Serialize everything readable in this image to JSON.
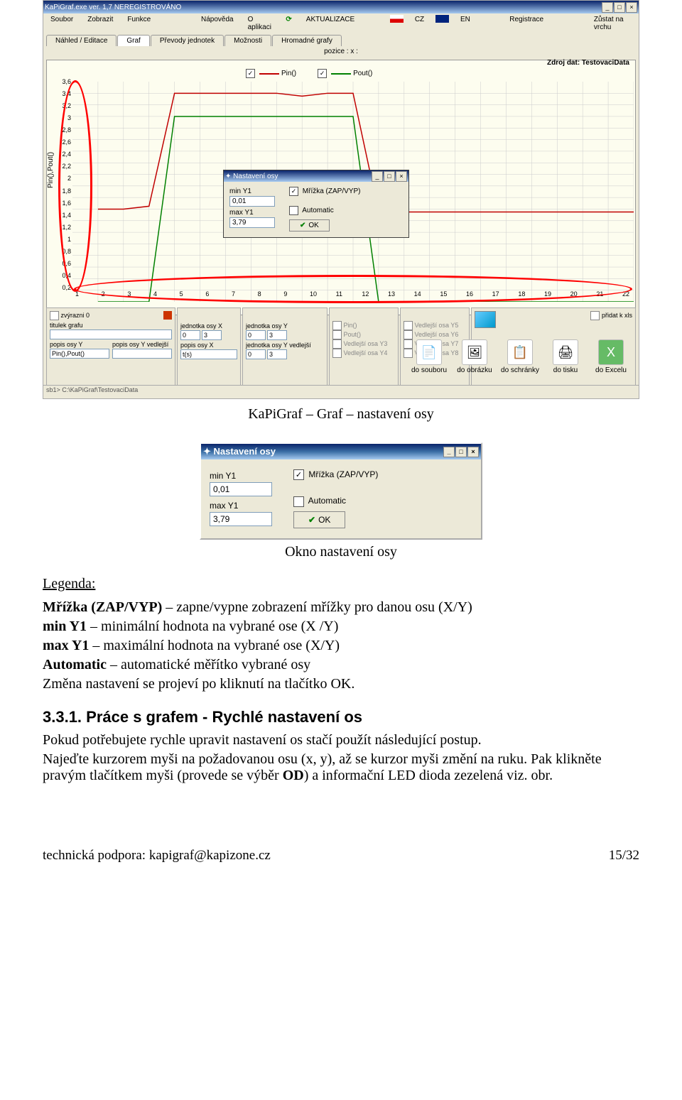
{
  "bigShot": {
    "title": "KaPiGraf.exe  ver. 1,7  NEREGISTROVÁNO",
    "menubar": [
      "Soubor",
      "Zobrazit",
      "Funkce",
      "Nápověda",
      "O aplikaci"
    ],
    "menubar2_update": "AKTUALIZACE",
    "langs": [
      "CZ",
      "EN"
    ],
    "menubar2_right": [
      "Registrace",
      "Zůstat na vrchu"
    ],
    "tabs": [
      "Náhled / Editace",
      "Graf",
      "Převody jednotek",
      "Možnosti",
      "Hromadné grafy"
    ],
    "poziceLabel": "pozice :   x :",
    "legendTitle": "Zdroj dat: TestovaciData",
    "legendItems": [
      "Pin()",
      "Pout()"
    ],
    "ylabel": "Pin(),Pout()",
    "xlabel": "t(s)",
    "yticks": [
      "3,6",
      "3,4",
      "3,2",
      "3",
      "2,8",
      "2,6",
      "2,4",
      "2,2",
      "2",
      "1,8",
      "1,6",
      "1,4",
      "1,2",
      "1",
      "0,8",
      "0,6",
      "0,4",
      "0,2"
    ],
    "xticks": [
      "1",
      "2",
      "3",
      "4",
      "5",
      "6",
      "7",
      "8",
      "9",
      "10",
      "11",
      "12",
      "13",
      "14",
      "15",
      "16",
      "17",
      "18",
      "19",
      "20",
      "21",
      "22"
    ],
    "dlg": {
      "title": "Nastavení osy",
      "minLbl": "min Y1",
      "minVal": "0,01",
      "maxLbl": "max Y1",
      "maxVal": "3,79",
      "grid": "Mřížka (ZAP/VYP)",
      "auto": "Automatic",
      "ok": "OK"
    },
    "bottomLeft": {
      "zv0": "zvýrazni 0",
      "titulek": "titulek grafu",
      "popisY": "popis osy Y",
      "popisYvedl": "popis osy Y vedlejší",
      "popisYval": "Pin(),Pout()",
      "jedX": "jednotka osy X",
      "popisX": "popis osy X",
      "popisXval": "t(s)",
      "jedY": "jednotka osy Y",
      "jedYvedl": "jednotka osy Y vedlejší",
      "val0": "0",
      "val3": "3"
    },
    "seriesChecks": [
      "Pin()",
      "Pout()",
      "Vedlejší osa Y3",
      "Vedlejší osa Y4",
      "Vedlejší osa Y5",
      "Vedlejší osa Y6",
      "Vedlejší osa Y7",
      "Vedlejší osa Y8"
    ],
    "pridat": "přidat k xls",
    "export": [
      "do souboru",
      "do obrázku",
      "do schránky",
      "do tisku",
      "do Excelu"
    ],
    "status": "sb1> C:\\KaPiGraf\\TestovaciData"
  },
  "dialog2": {
    "title": "Nastavení osy",
    "minLbl": "min Y1",
    "minVal": "0,01",
    "maxLbl": "max Y1",
    "maxVal": "3,79",
    "grid": "Mřížka (ZAP/VYP)",
    "auto": "Automatic",
    "ok": "OK"
  },
  "doc": {
    "caption": "KaPiGraf – Graf – nastavení osy",
    "sub": "Okno nastavení osy",
    "legendHdr": "Legenda:",
    "p1a": "Mřížka (ZAP/VYP)",
    "p1b": " – zapne/vypne zobrazení mřížky pro danou osu (X/Y)",
    "p2a": "min Y1",
    "p2b": " – minimální hodnota na vybrané ose (X /Y)",
    "p3a": "max Y1",
    "p3b": " – maximální hodnota na vybrané ose (X/Y)",
    "p4a": "Automatic",
    "p4b": " – automatické měřítko vybrané osy",
    "p5": "Změna nastavení se projeví po kliknutí na tlačítko OK.",
    "sec": "3.3.1. Práce s grafem -  Rychlé nastavení os",
    "body1": "Pokud potřebujete rychle upravit nastavení os stačí použít následující postup.",
    "body2a": "Najeďte kurzorem myši na požadovanou osu (x, y), až se kurzor myši změní na ruku. Pak klikněte pravým tlačítkem myši (provede se výběr ",
    "body2b": "OD",
    "body2c": ") a informační LED dioda zezelená viz. obr.",
    "footerL": "technická podpora: kapigraf@kapizone.cz",
    "footerR": "15/32"
  },
  "chart_data": {
    "type": "line",
    "title": "Zdroj dat: TestovaciData",
    "xlabel": "t(s)",
    "ylabel": "Pin(),Pout()",
    "ylim": [
      0,
      3.8
    ],
    "xlim": [
      0,
      22
    ],
    "x": [
      1,
      2,
      3,
      4,
      5,
      6,
      7,
      8,
      9,
      10,
      11,
      12,
      13,
      14,
      15,
      16,
      17,
      18,
      19,
      20,
      21,
      22
    ],
    "series": [
      {
        "name": "Pin()",
        "color": "#c00000",
        "values": [
          1.6,
          1.6,
          1.65,
          3.6,
          3.6,
          3.6,
          3.6,
          3.6,
          3.55,
          3.6,
          3.6,
          1.55,
          1.55,
          1.55,
          1.55,
          1.55,
          1.55,
          1.55,
          1.55,
          1.55,
          1.55,
          1.55
        ]
      },
      {
        "name": "Pout()",
        "color": "#008000",
        "values": [
          0.0,
          0.0,
          0.0,
          3.2,
          3.2,
          3.2,
          3.2,
          3.2,
          3.2,
          3.2,
          3.2,
          0.0,
          0.0,
          0.0,
          0.0,
          0.0,
          0.0,
          0.0,
          0.0,
          0.0,
          0.0,
          0.0
        ]
      }
    ]
  }
}
